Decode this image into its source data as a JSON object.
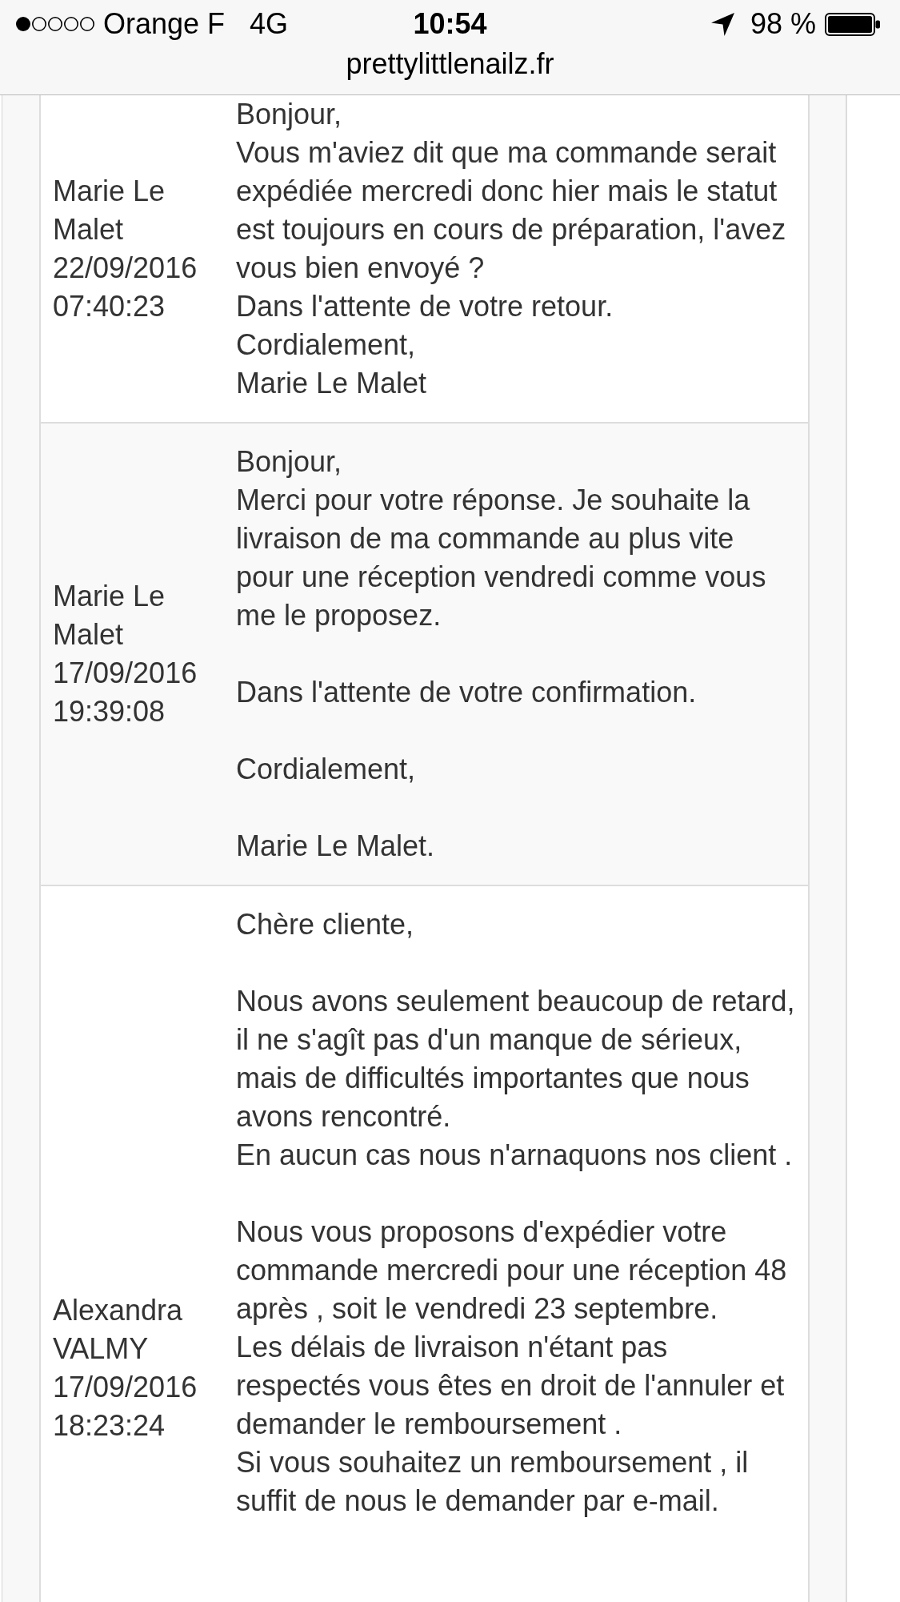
{
  "status_bar": {
    "carrier": "Orange F",
    "network": "4G",
    "time": "10:54",
    "battery": "98 %"
  },
  "address_bar": {
    "url": "prettylittlenailz.fr"
  },
  "messages": [
    {
      "author": "Marie Le Malet",
      "date": "22/09/2016 07:40:23",
      "text": "Bonjour,\nVous m'aviez dit que ma commande serait expédiée mercredi donc hier mais le statut est toujours en cours de préparation, l'avez vous bien envoyé ?\nDans l'attente de votre retour.\nCordialement,\nMarie Le Malet"
    },
    {
      "author": "Marie Le Malet",
      "date": "17/09/2016 19:39:08",
      "text": "Bonjour,\nMerci pour votre réponse. Je souhaite la livraison de ma commande au plus vite pour une réception vendredi comme vous me le proposez.\n\nDans l'attente de votre confirmation.\n\nCordialement,\n\nMarie Le Malet."
    },
    {
      "author": "Alexandra VALMY",
      "date": "17/09/2016 18:23:24",
      "text": "Chère cliente,\n\nNous avons seulement beaucoup de retard, il ne s'agît pas d'un manque de sérieux, mais de difficultés importantes que nous avons rencontré.\nEn aucun cas nous n'arnaquons nos client .\n\nNous vous proposons d'expédier votre commande mercredi pour une réception 48 après , soit le vendredi 23 septembre.\nLes délais de livraison n'étant pas respectés vous êtes en droit de l'annuler et demander le remboursement .\nSi vous souhaitez un remboursement , il suffit de nous le demander par e-mail."
    }
  ]
}
